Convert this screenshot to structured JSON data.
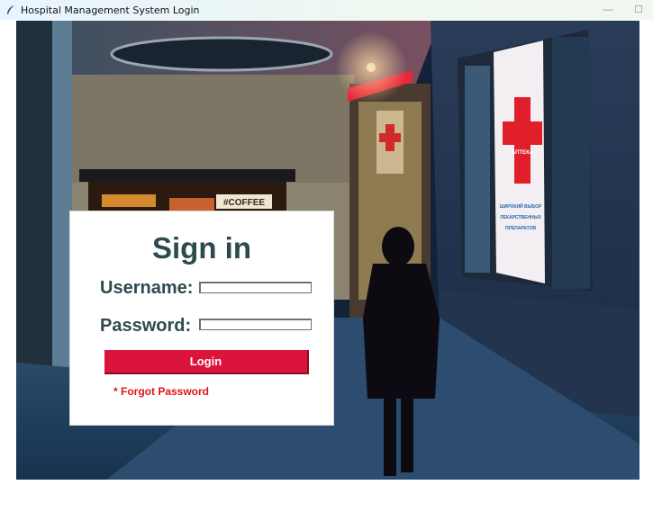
{
  "window": {
    "title": "Hospital Management System Login",
    "minimize_glyph": "—",
    "maximize_glyph": "☐",
    "app_icon": "feather-icon"
  },
  "background": {
    "signs": {
      "coffee": "#COFFEE",
      "pharmacy": "АПТЕКА",
      "window_text_1": "ШИРОКИЙ ВЫБОР",
      "window_text_2": "ЛЕКАРСТВЕННЫХ",
      "window_text_3": "ПРЕПАРАТОВ"
    }
  },
  "login": {
    "heading": "Sign in",
    "username_label": "Username:",
    "username_value": "",
    "password_label": "Password:",
    "password_value": "",
    "login_button": "Login",
    "forgot_link": "* Forgot Password"
  },
  "colors": {
    "accent_button": "#dc143c",
    "heading_text": "#2d4b4f",
    "forgot_text": "#e01414"
  }
}
